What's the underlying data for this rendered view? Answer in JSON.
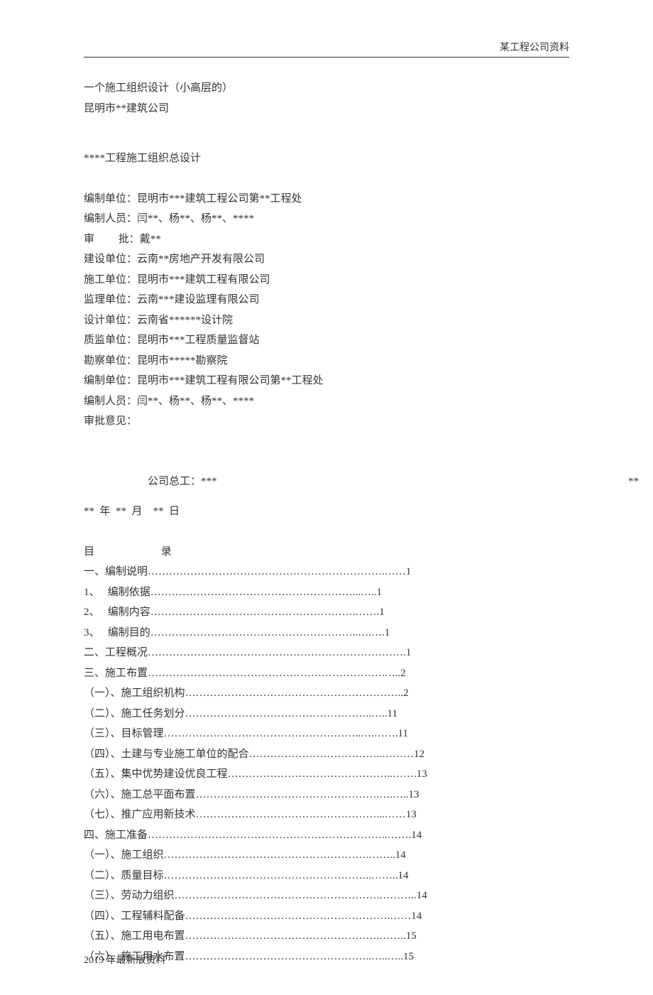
{
  "header": {
    "right": "某工程公司资料"
  },
  "body": [
    "一个施工组织设计（小高层的）",
    "昆明市**建筑公司",
    "",
    "",
    "****工程施工组织总设计",
    "",
    "编制单位：昆明市***建筑工程公司第**工程处",
    "编制人员：闫**、杨**、杨**、****",
    "审         批：戴**",
    "建设单位：云南**房地产开发有限公司",
    "施工单位：昆明市***建筑工程有限公司",
    "监理单位：云南***建设监理有限公司",
    "设计单位：云南省******设计院",
    "质监单位：昆明市***工程质量监督站",
    "勘察单位：昆明市*****勘察院",
    "编制单位：昆明市***建筑工程有限公司第**工程处",
    "编制人员：闫**、杨**、杨**、****",
    "审批意见："
  ],
  "chief": {
    "left": "公司总工：***",
    "right": "**"
  },
  "date": "**  年  **  月    **  日",
  "toc_title": "目                         录",
  "toc": [
    "一、编制说明………………………………………………………….……1",
    "1、   编制依据…………………………………………………...…..1",
    "2、   编制内容………………………………………………….…….1",
    "3、   编制目的…………………………………………………..….….1",
    "二、工程概况……………………………………………………………….1",
    "三、施工布置………………………………………………………….…..2",
    "（一）、施工组织机构……………………………………………………..2",
    "（二）、施工任务划分……………………………………………..…..11",
    "（三）、目标管理………………………………………………..….…….11",
    "（四）、土建与专业施工单位的配合………………………………..………12",
    "（五）、集中优势建设优良工程………………………………………..…….13",
    "（六）、施工总平面布置…………………………………………….….…..13",
    "（七）、推广应用新技术……………………………………………...……13",
    "四、施工准备…………………………………………………………..…….14",
    "（一）、施工组织………………………………………………….……..14",
    "（二）、质量目标…………………………………………………..……..14",
    "（三）、劳动力组织………………………………………………….………..14",
    "（四）、工程辅料配备………………………………………………….……14",
    "（五）、施工用电布置……………………………………………….……..15",
    "（六）、施工用水布置……………………………………………..…..…..15"
  ],
  "footer": "2019 年最新版资料"
}
